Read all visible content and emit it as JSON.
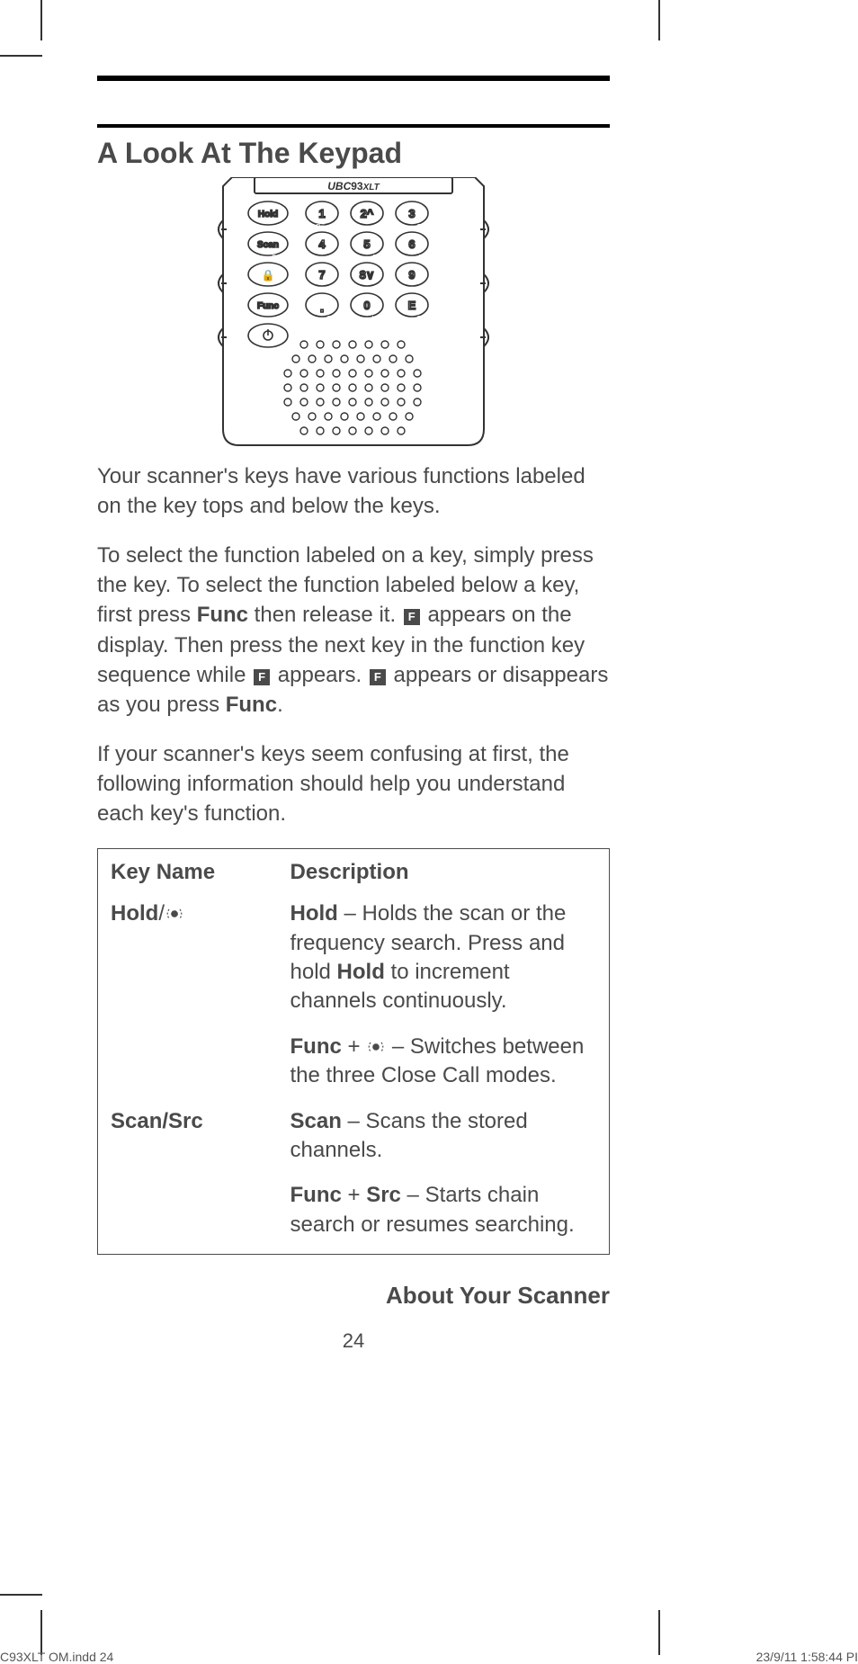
{
  "heading": "A Look At The Keypad",
  "device_model": "UBC93XLT",
  "keypad_labels": {
    "row1": [
      "Hold",
      "1",
      "2^",
      "3"
    ],
    "row1_sub": [
      "",
      "Pri",
      "",
      "Svc"
    ],
    "row2": [
      "Scan",
      "4",
      "5",
      "6"
    ],
    "row2_sub": [
      "Src",
      "",
      "Dly",
      "PSrc"
    ],
    "row3": [
      "🔒",
      "7",
      "8∨",
      "9"
    ],
    "row3_sub": [
      "",
      "",
      "",
      ""
    ],
    "row4": [
      "Func",
      ".",
      "0",
      "E"
    ],
    "row4_sub": [
      "",
      "Clr",
      "L/O",
      "Pgm"
    ],
    "power": "⏻"
  },
  "para1": "Your scanner's keys have various functions labeled on the key tops and below the keys.",
  "para2_a": "To select the function labeled on a key, simply press the key. To select the function labeled below a key, first press ",
  "para2_func": "Func",
  "para2_b": " then release it. ",
  "para2_c": " appears on the display. Then press the next key in the function key sequence while ",
  "para2_d": " appears. ",
  "para2_e": " appears or disappears as you press ",
  "para2_f": ".",
  "para3": "If your scanner's keys seem confusing at first, the following information should help you understand each key's function.",
  "table": {
    "headers": [
      "Key Name",
      "Description"
    ],
    "rows": [
      {
        "key_name_bold": "Hold",
        "key_name_suffix": "/",
        "desc1_bold": "Hold",
        "desc1_text": " – Holds the scan or the frequency search. Press and hold ",
        "desc1_bold2": "Hold",
        "desc1_text2": " to increment channels continuously.",
        "desc2_bold": "Func",
        "desc2_plus": " + ",
        "desc2_text": " – Switches between the three Close Call modes."
      },
      {
        "key_name_bold": "Scan/Src",
        "key_name_suffix": "",
        "desc1_bold": "Scan",
        "desc1_text": " – Scans the stored channels.",
        "desc1_bold2": "",
        "desc1_text2": "",
        "desc2_bold": "Func",
        "desc2_plus": " + ",
        "desc2_bold2": "Src",
        "desc2_text": " – Starts chain search or resumes searching."
      }
    ]
  },
  "section_footer": "About Your Scanner",
  "page_number": "24",
  "slug_left": "C93XLT OM.indd   24",
  "slug_right": "23/9/11   1:58:44 PI",
  "f_glyph": "F"
}
